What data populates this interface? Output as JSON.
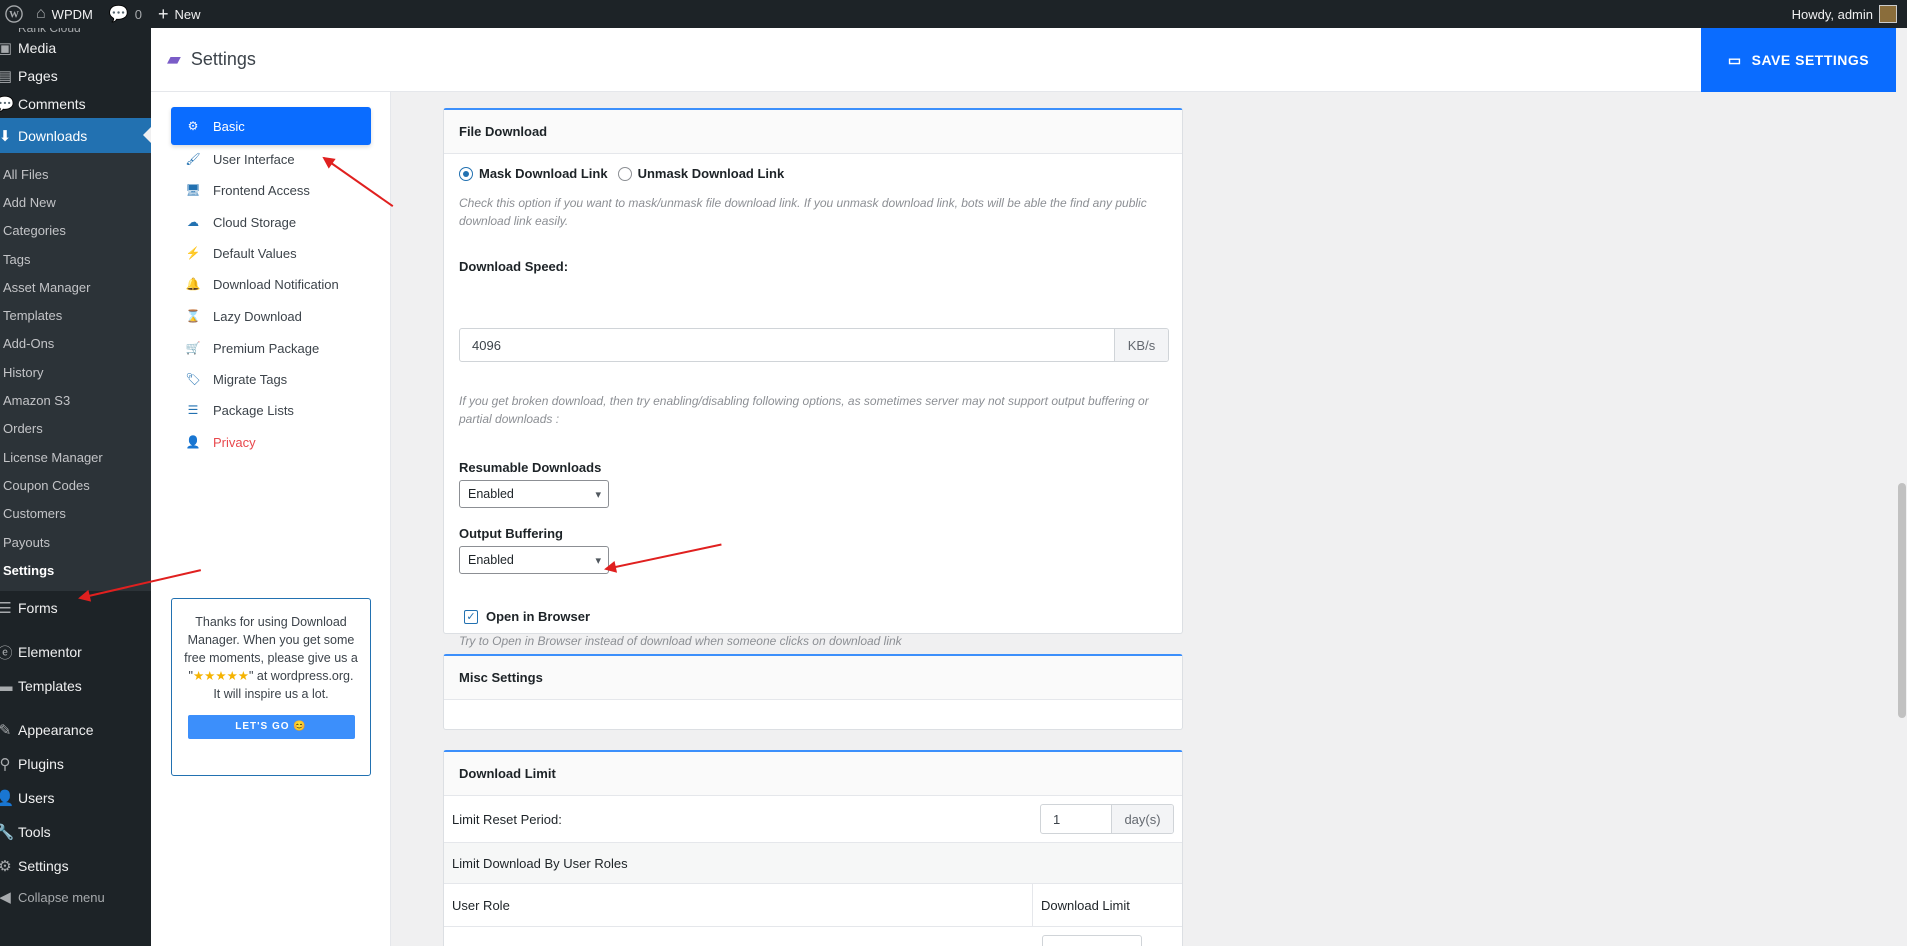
{
  "admin_bar": {
    "site_name": "WPDM",
    "comments_count": "0",
    "new_label": "New",
    "howdy": "Howdy, admin"
  },
  "admin_menu": {
    "top_partial": "Rank Cloud",
    "items_top": [
      {
        "label": "Media",
        "icon": "media-icon"
      },
      {
        "label": "Pages",
        "icon": "pages-icon"
      },
      {
        "label": "Comments",
        "icon": "comments-icon"
      }
    ],
    "current": {
      "label": "Downloads",
      "icon": "download-icon"
    },
    "submenu": [
      "All Files",
      "Add New",
      "Categories",
      "Tags",
      "Asset Manager",
      "Templates",
      "Add-Ons",
      "History",
      "Amazon S3",
      "Orders",
      "License Manager",
      "Coupon Codes",
      "Customers",
      "Payouts",
      "Settings"
    ],
    "submenu_active": "Settings",
    "items_bottom": [
      {
        "label": "Forms",
        "icon": "forms-icon"
      },
      {
        "label": "Elementor",
        "icon": "elementor-icon"
      },
      {
        "label": "Templates",
        "icon": "folder-icon"
      },
      {
        "label": "Appearance",
        "icon": "brush-icon"
      },
      {
        "label": "Plugins",
        "icon": "plugin-icon"
      },
      {
        "label": "Users",
        "icon": "users-icon"
      },
      {
        "label": "Tools",
        "icon": "wrench-icon"
      },
      {
        "label": "Settings",
        "icon": "settings-icon"
      },
      {
        "label": "Collapse menu",
        "icon": "collapse-icon"
      }
    ]
  },
  "header": {
    "title": "Settings",
    "save_label": "SAVE SETTINGS"
  },
  "settings_nav": {
    "items": [
      {
        "label": "Basic",
        "icon": "gear-icon",
        "glyph": "⚙"
      },
      {
        "label": "User Interface",
        "icon": "paint-bucket-icon",
        "glyph": "🖌"
      },
      {
        "label": "Frontend Access",
        "icon": "monitor-icon",
        "glyph": "🖥"
      },
      {
        "label": "Cloud Storage",
        "icon": "cloud-icon",
        "glyph": "☁"
      },
      {
        "label": "Default Values",
        "icon": "bolt-icon",
        "glyph": "⚡"
      },
      {
        "label": "Download Notification",
        "icon": "bell-icon",
        "glyph": "🔔"
      },
      {
        "label": "Lazy Download",
        "icon": "hourglass-icon",
        "glyph": "⌛"
      },
      {
        "label": "Premium Package",
        "icon": "cart-icon",
        "glyph": "🛒"
      },
      {
        "label": "Migrate Tags",
        "icon": "tags-icon",
        "glyph": "🏷"
      },
      {
        "label": "Package Lists",
        "icon": "list-icon",
        "glyph": "☰"
      },
      {
        "label": "Privacy",
        "icon": "user-lock-icon",
        "glyph": "👤"
      }
    ],
    "promo": {
      "line1": "Thanks for using Download Manager. When you get some free moments, please give us a \"",
      "stars": "★★★★★",
      "line2": "\" at wordpress.org.",
      "line3": "It will inspire us a lot.",
      "button": "LET'S GO 😊"
    }
  },
  "file_download": {
    "title": "File Download",
    "mask_label": "Mask Download Link",
    "unmask_label": "Unmask Download Link",
    "mask_help": "Check this option if you want to mask/unmask file download link. If you unmask download link, bots will be able the find any public download link easily.",
    "speed_label": "Download Speed:",
    "speed_value": "4096",
    "speed_unit": "KB/s",
    "broken_help": "If you get broken download, then try enabling/disabling following options, as sometimes server may not support output buffering or partial downloads :",
    "resumable_label": "Resumable Downloads",
    "resumable_value": "Enabled",
    "buffering_label": "Output Buffering",
    "buffering_value": "Enabled",
    "browser_label": "Open in Browser",
    "browser_help": "Try to Open in Browser instead of download when someone clicks on download link"
  },
  "misc": {
    "title": "Misc Settings"
  },
  "download_limit": {
    "title": "Download Limit",
    "reset_label": "Limit Reset Period:",
    "reset_value": "1",
    "reset_unit": "day(s)",
    "by_roles_label": "Limit Download By User Roles",
    "col_role": "User Role",
    "col_limit": "Download Limit"
  }
}
